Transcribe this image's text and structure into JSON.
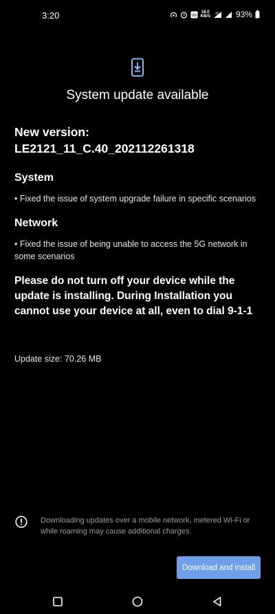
{
  "status_bar": {
    "time": "3:20",
    "net_speed_value": "18.0",
    "net_speed_unit": "KB/S",
    "battery_percent": "93%"
  },
  "header": {
    "title": "System update available"
  },
  "release": {
    "new_version_label": "New version:",
    "version": "LE2121_11_C.40_202112261318",
    "sections": [
      {
        "heading": "System",
        "item": "• Fixed the issue of system upgrade failure in specific scenarios"
      },
      {
        "heading": "Network",
        "item": "• Fixed the issue of being unable to access the 5G network in some scenarios"
      }
    ],
    "warning": "Please do not turn off your device while the update is installing. During Installation you cannot use your device at all, even to dial 9-1-1",
    "update_size": "Update size: 70.26 MB"
  },
  "notice": {
    "text": "Downloading updates over a mobile network, metered Wi-Fi or while roaming may cause additional charges."
  },
  "actions": {
    "download_label": "Download and install"
  },
  "colors": {
    "background": "#000000",
    "accent_button": "#6f9fe8",
    "update_icon": "#8ab4f8",
    "notice_text": "#9c9c9c"
  },
  "icons": {
    "header": "phone-download-icon",
    "notice": "info-icon",
    "nav": [
      "recents-square-icon",
      "home-circle-icon",
      "back-triangle-icon"
    ]
  }
}
